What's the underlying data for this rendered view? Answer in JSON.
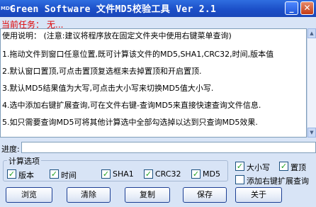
{
  "window": {
    "icon_text": "MD5",
    "title": "Green Software 文件MD5校验工具 Ver 2.1",
    "minimize_label": "_",
    "close_label": "✕"
  },
  "task": {
    "label": "当前任务：",
    "value": "无..."
  },
  "instructions": {
    "heading": "使用说明：  (注意:建议将程序放在固定文件夹中使用右键菜单查询)",
    "items": [
      "1.拖动文件到窗口任意位置,既可计算该文件的MD5,SHA1,CRC32,时间,版本值",
      "2.默认窗口置顶,可点击置顶复选框来去掉置顶和开启置顶.",
      "3.默认MD5结果值为大写,可点击大小写来切换MD5值大小写.",
      "4.选中添加右键扩展查询,可在文件右键-查询MD5来直接快速查询文件信息.",
      "5.如只需要查询MD5可将其他计算选中全部勾选掉以达到只查询MD5效果."
    ]
  },
  "progress": {
    "label": "进度:",
    "value": 0
  },
  "options_group": {
    "title": "计算选项",
    "checkboxes": [
      {
        "label": "版本",
        "checked": true
      },
      {
        "label": "时间",
        "checked": true
      },
      {
        "label": "SHA1",
        "checked": true
      },
      {
        "label": "CRC32",
        "checked": true
      },
      {
        "label": "MD5",
        "checked": true
      }
    ]
  },
  "side_options": [
    {
      "label": "大小写",
      "checked": true
    },
    {
      "label": "置顶",
      "checked": true
    },
    {
      "label": "添加右键扩展查询",
      "checked": false
    }
  ],
  "buttons": {
    "browse": "浏览",
    "clear": "清除",
    "copy": "复制",
    "save": "保存",
    "about": "关于"
  },
  "colors": {
    "title_bar": "#1c4fc8",
    "task_text": "#e00000",
    "check_mark": "#21a121"
  }
}
